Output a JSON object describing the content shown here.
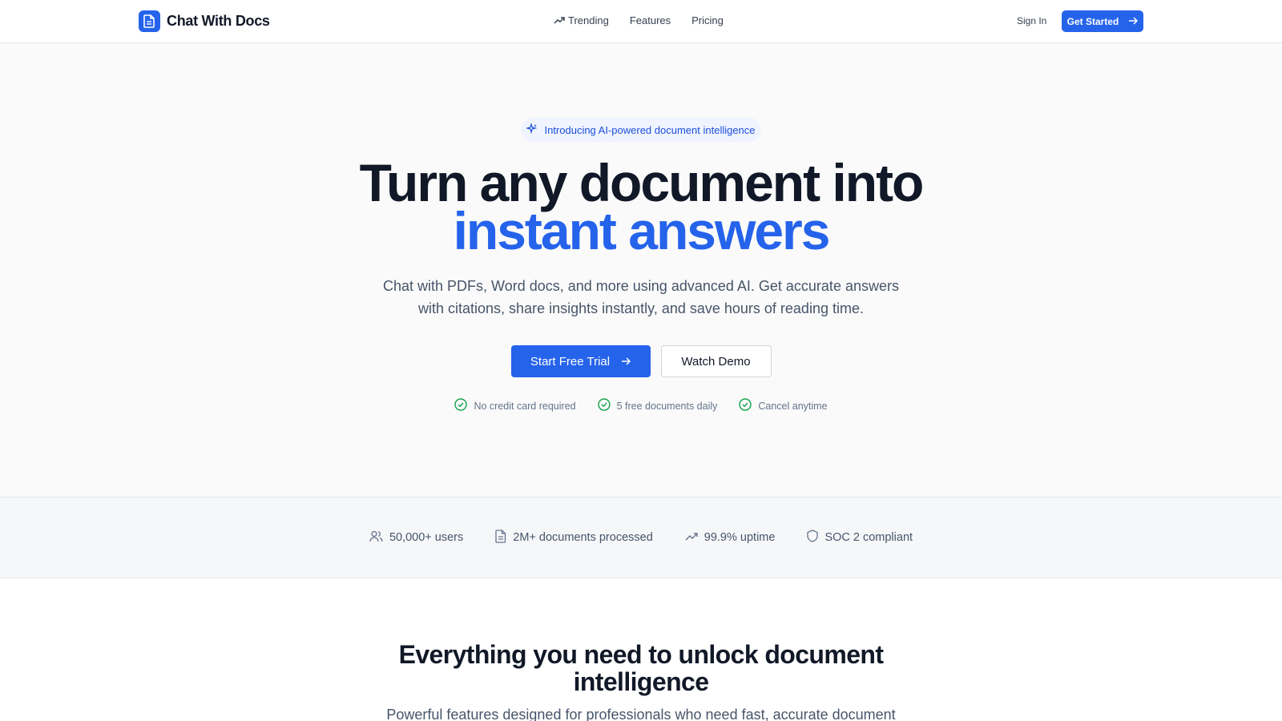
{
  "header": {
    "brand": "Chat With Docs",
    "nav": [
      {
        "label": "Trending",
        "icon": "trending-up-icon"
      },
      {
        "label": "Features"
      },
      {
        "label": "Pricing"
      }
    ],
    "sign_in": "Sign In",
    "get_started": "Get Started"
  },
  "hero": {
    "badge": "Introducing AI-powered document intelligence",
    "title_line1": "Turn any document into",
    "title_line2": "instant answers",
    "subtitle": "Chat with PDFs, Word docs, and more using advanced AI. Get accurate answers with citations, share insights instantly, and save hours of reading time.",
    "primary_cta": "Start Free Trial",
    "secondary_cta": "Watch Demo",
    "checks": [
      "No credit card required",
      "5 free documents daily",
      "Cancel anytime"
    ]
  },
  "stats": [
    {
      "label": "50,000+ users",
      "icon": "users-icon"
    },
    {
      "label": "2M+ documents processed",
      "icon": "document-icon"
    },
    {
      "label": "99.9% uptime",
      "icon": "trending-up-icon"
    },
    {
      "label": "SOC 2 compliant",
      "icon": "shield-icon"
    }
  ],
  "features": {
    "title": "Everything you need to unlock document intelligence",
    "subtitle": "Powerful features designed for professionals who need fast, accurate document"
  },
  "colors": {
    "accent": "#2563eb",
    "check_green": "#16a34a",
    "text_dark": "#111827",
    "text_muted": "#475569"
  }
}
